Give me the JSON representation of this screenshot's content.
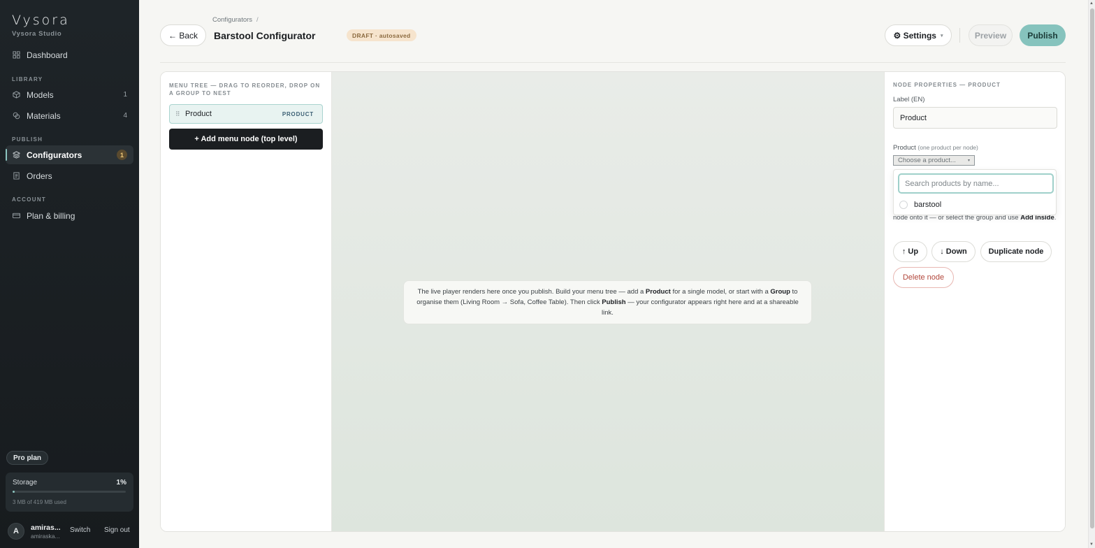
{
  "sidebar": {
    "brand": "Vysora",
    "brand_sub": "Vysora Studio",
    "dashboard": "Dashboard",
    "sections": {
      "library": "LIBRARY",
      "publish": "PUBLISH",
      "account": "ACCOUNT"
    },
    "models": {
      "label": "Models",
      "count": "1"
    },
    "materials": {
      "label": "Materials",
      "count": "4"
    },
    "configurators": {
      "label": "Configurators",
      "count": "1"
    },
    "orders": "Orders",
    "plan_billing": "Plan & billing",
    "plan_pill": "Pro plan",
    "storage": {
      "label": "Storage",
      "percent": "1%",
      "fill_fraction": 0.01,
      "used": "3 MB of 419 MB used"
    },
    "user": {
      "initial": "A",
      "name": "amiras...",
      "email": "amiraska...",
      "switch": "Switch",
      "signout": "Sign out"
    }
  },
  "header": {
    "breadcrumb": "Configurators",
    "breadcrumb_sep": "/",
    "back": "← Back",
    "title": "Barstool Configurator",
    "status": "DRAFT · autosaved",
    "settings": "⚙ Settings",
    "settings_caret": "▾",
    "preview": "Preview",
    "publish": "Publish"
  },
  "tree": {
    "heading": "MENU TREE — DRAG TO REORDER, DROP ON A GROUP TO NEST",
    "node": {
      "grip": "⠿",
      "label": "Product",
      "type": "PRODUCT"
    },
    "add_button": "+ Add menu node (top level)"
  },
  "canvas": {
    "msg_1": "The live player renders here once you publish. Build your menu tree — add a ",
    "msg_product": "Product",
    "msg_2": " for a single model, or start with a ",
    "msg_group": "Group",
    "msg_3": " to organise them (Living Room → Sofa, Coffee Table). Then click ",
    "msg_publish": "Publish",
    "msg_4": " — your configurator appears right here and at a shareable link."
  },
  "props": {
    "heading": "NODE PROPERTIES — PRODUCT",
    "label_field": {
      "label": "Label (EN)",
      "value": "Product"
    },
    "product_field": {
      "label": "Product",
      "hint": "(one product per node)",
      "selected": "Choose a product...",
      "caret": "▾"
    },
    "dropdown": {
      "placeholder": "Search products by name...",
      "options": [
        "barstool"
      ]
    },
    "help_1": "node onto it — or select the group and use ",
    "help_bold": "Add inside",
    "help_2": ".",
    "buttons": {
      "up": "↑ Up",
      "down": "↓ Down",
      "duplicate": "Duplicate node",
      "delete": "Delete node"
    }
  },
  "colors": {
    "accent": "#86c3bd",
    "sidebar_bg": "#1b2024",
    "draft_bg": "#f6e4cd",
    "danger": "#b2473c"
  }
}
